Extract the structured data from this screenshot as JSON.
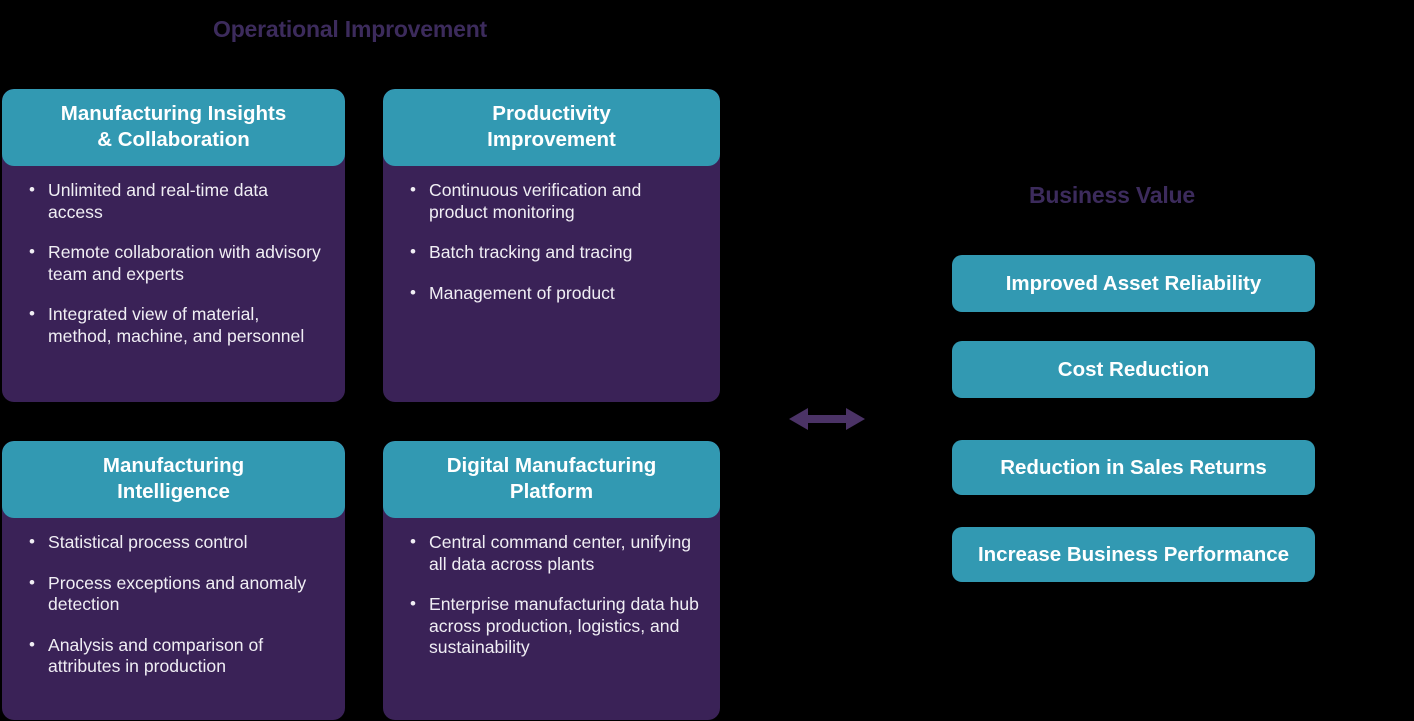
{
  "colors": {
    "background": "#000000",
    "teal": "#3299b2",
    "purple": "#3a2257",
    "title_purple": "#3c2b5c",
    "body_text": "#f0eef4"
  },
  "operational_improvement": {
    "title": "Operational Improvement",
    "cards": [
      {
        "title": "Manufacturing Insights\n& Collaboration",
        "title_line1": "Manufacturing Insights",
        "title_line2": "& Collaboration",
        "bullets": [
          "Unlimited and real-time data access",
          "Remote collaboration with advisory team and experts",
          "Integrated view of material, method, machine, and personnel"
        ]
      },
      {
        "title": "Productivity Improvement",
        "title_line1": "Productivity",
        "title_line2": "Improvement",
        "bullets": [
          "Continuous verification and product monitoring",
          "Batch tracking and tracing",
          "Management of product"
        ]
      },
      {
        "title": "Manufacturing Intelligence",
        "title_line1": "Manufacturing",
        "title_line2": "Intelligence",
        "bullets": [
          "Statistical process control",
          "Process exceptions and anomaly detection",
          "Analysis and comparison of attributes in production"
        ]
      },
      {
        "title": "Digital Manufacturing Platform",
        "title_line1": "Digital Manufacturing",
        "title_line2": "Platform",
        "bullets": [
          "Central command center, unifying all data across plants",
          "Enterprise manufacturing data hub across production, logistics, and sustainability"
        ]
      }
    ]
  },
  "connector": {
    "icon": "double-headed-arrow-icon",
    "color": "#4b3366"
  },
  "business_value": {
    "title": "Business Value",
    "items": [
      {
        "label": "Improved Asset Reliability"
      },
      {
        "label": "Cost Reduction"
      },
      {
        "label": "Reduction in Sales Returns"
      },
      {
        "label": "Increase Business Performance"
      }
    ]
  }
}
